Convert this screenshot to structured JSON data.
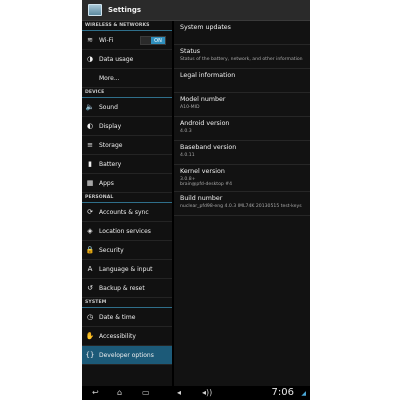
{
  "app": {
    "title": "Settings"
  },
  "left": {
    "sections": [
      {
        "header": "WIRELESS & NETWORKS",
        "items": [
          {
            "label": "Wi-Fi",
            "icon": "wifi-icon",
            "toggle": "ON"
          },
          {
            "label": "Data usage",
            "icon": "data-usage-icon"
          },
          {
            "label": "More...",
            "icon": ""
          }
        ]
      },
      {
        "header": "DEVICE",
        "items": [
          {
            "label": "Sound",
            "icon": "sound-icon"
          },
          {
            "label": "Display",
            "icon": "display-icon"
          },
          {
            "label": "Storage",
            "icon": "storage-icon"
          },
          {
            "label": "Battery",
            "icon": "battery-icon"
          },
          {
            "label": "Apps",
            "icon": "apps-icon"
          }
        ]
      },
      {
        "header": "PERSONAL",
        "items": [
          {
            "label": "Accounts & sync",
            "icon": "sync-icon"
          },
          {
            "label": "Location services",
            "icon": "location-icon"
          },
          {
            "label": "Security",
            "icon": "lock-icon"
          },
          {
            "label": "Language & input",
            "icon": "language-icon"
          },
          {
            "label": "Backup & reset",
            "icon": "backup-icon"
          }
        ]
      },
      {
        "header": "SYSTEM",
        "items": [
          {
            "label": "Date & time",
            "icon": "clock-icon"
          },
          {
            "label": "Accessibility",
            "icon": "accessibility-icon"
          },
          {
            "label": "Developer options",
            "icon": "developer-icon",
            "selected": true
          }
        ]
      }
    ]
  },
  "right": {
    "items": [
      {
        "title": "System updates",
        "sub": ""
      },
      {
        "title": "Status",
        "sub": "Status of the battery, network, and other information"
      },
      {
        "title": "Legal information",
        "sub": ""
      },
      {
        "title": "Model number",
        "sub": "A10-MID"
      },
      {
        "title": "Android version",
        "sub": "4.0.3"
      },
      {
        "title": "Baseband version",
        "sub": "4.0.11"
      },
      {
        "title": "Kernel version",
        "sub": "3.0.8+\nbrain@pfd-desktop #4"
      },
      {
        "title": "Build number",
        "sub": "nuclear_pfd98-eng 4.0.3 IML74K 20130515 test-keys"
      }
    ]
  },
  "navbar": {
    "time": "7:06"
  },
  "colors": {
    "accent": "#2f8fbd",
    "selected": "#1c5a78"
  }
}
